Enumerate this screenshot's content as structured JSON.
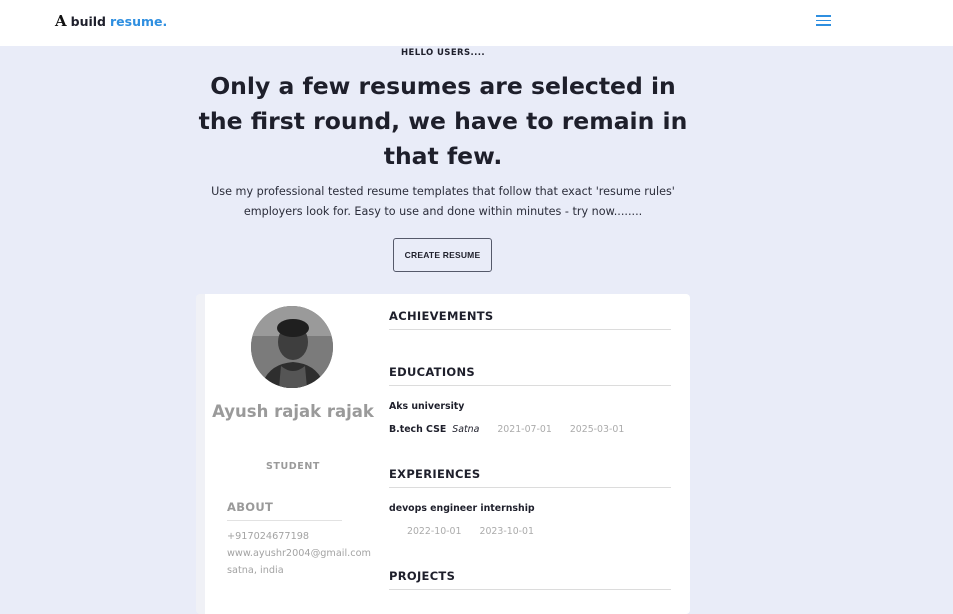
{
  "header": {
    "logo_mark": "A",
    "logo_word": "build",
    "logo_accent": "resume.",
    "menu_icon": "hamburger-menu-icon",
    "accent_color": "#2f8fe0"
  },
  "hero": {
    "eyebrow": "HELLO USERS....",
    "headline": "Only a few resumes are selected in the first round, we have to remain in that few.",
    "subtext": "Use my professional tested resume templates that follow that exact 'resume rules' employers look for. Easy to use and done within minutes - try now........",
    "cta_label": "CREATE RESUME"
  },
  "resume": {
    "name": "Ayush rajak rajak",
    "role": "STUDENT",
    "about": {
      "title": "ABOUT",
      "phone": "+917024677198",
      "email": "www.ayushr2004@gmail.com",
      "location": "satna, india"
    },
    "achievements": {
      "title": "ACHIEVEMENTS"
    },
    "educations": {
      "title": "EDUCATIONS",
      "institution": "Aks university",
      "degree": "B.tech CSE",
      "place": "Satna",
      "start": "2021-07-01",
      "end": "2025-03-01"
    },
    "experiences": {
      "title": "EXPERIENCES",
      "position": "devops engineer internship",
      "start": "2022-10-01",
      "end": "2023-10-01"
    },
    "projects": {
      "title": "PROJECTS"
    }
  }
}
